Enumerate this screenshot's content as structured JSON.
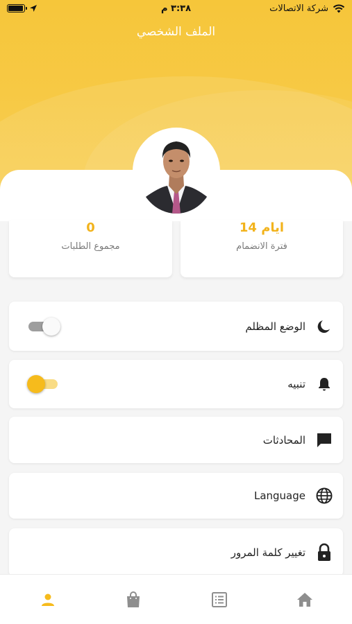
{
  "status_bar": {
    "time": "٣:٣٨ م",
    "carrier": "شركة الاتصالات"
  },
  "header": {
    "title": "الملف الشخصي"
  },
  "stats": [
    {
      "value": "14 ايام",
      "label": "فترة الانضمام"
    },
    {
      "value": "0",
      "label": "مجموع الطلبات"
    }
  ],
  "settings": {
    "dark_mode": {
      "label": "الوضع المظلم",
      "icon": "moon-icon",
      "enabled": false
    },
    "notifications": {
      "label": "تنبيه",
      "icon": "bell-icon",
      "enabled": true
    },
    "chats": {
      "label": "المحادثات",
      "icon": "chat-icon"
    },
    "language": {
      "label": "Language",
      "icon": "globe-icon"
    },
    "change_password": {
      "label": "تغيير كلمة المرور",
      "icon": "lock-icon"
    }
  },
  "bottom_nav": {
    "items": [
      "profile-icon",
      "bag-icon",
      "list-icon",
      "home-icon"
    ],
    "active": "profile-icon"
  },
  "colors": {
    "accent": "#f6bb1c",
    "header": "#f7c944",
    "toggle_on_track": "#f9dc85",
    "toggle_off_track": "#9e9e9e",
    "icon": "#222222",
    "nav_inactive": "#8e8e8e"
  }
}
